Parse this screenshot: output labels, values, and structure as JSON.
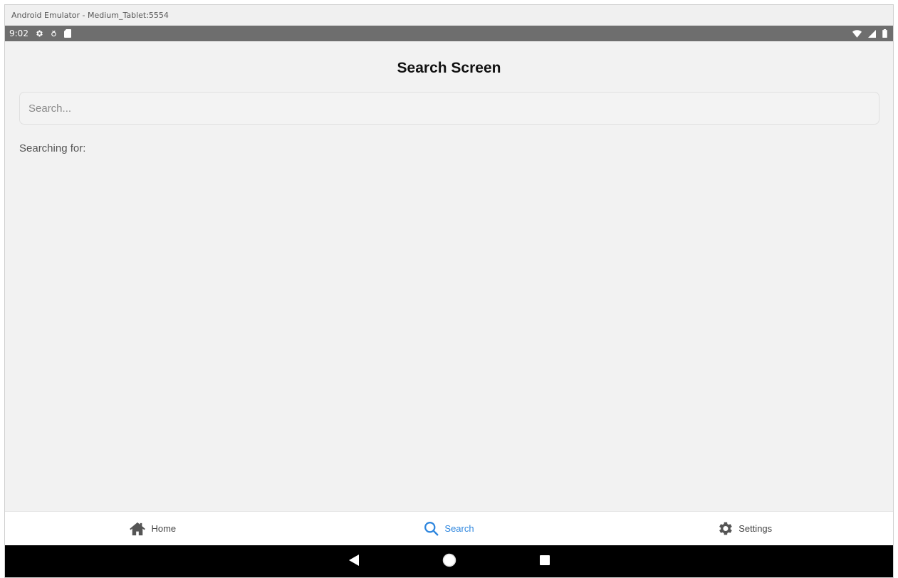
{
  "window": {
    "title": "Android Emulator - Medium_Tablet:5554"
  },
  "statusbar": {
    "time": "9:02",
    "left_icons": [
      "gear-icon",
      "usb-debug-icon",
      "sd-card-icon"
    ],
    "right_icons": [
      "wifi-icon",
      "signal-icon",
      "battery-icon"
    ]
  },
  "screen": {
    "title": "Search Screen",
    "search": {
      "placeholder": "Search...",
      "value": ""
    },
    "searching_label": "Searching for:"
  },
  "tabs": [
    {
      "label": "Home",
      "icon": "home-icon",
      "active": false
    },
    {
      "label": "Search",
      "icon": "search-icon",
      "active": true
    },
    {
      "label": "Settings",
      "icon": "gear-icon",
      "active": false
    }
  ],
  "colors": {
    "accent": "#2e86de",
    "statusbar": "#6e6e6e",
    "background": "#f2f2f2",
    "systembar": "#000000"
  },
  "systembar": {
    "buttons": [
      "back-icon",
      "home-circle-icon",
      "recents-icon"
    ]
  }
}
